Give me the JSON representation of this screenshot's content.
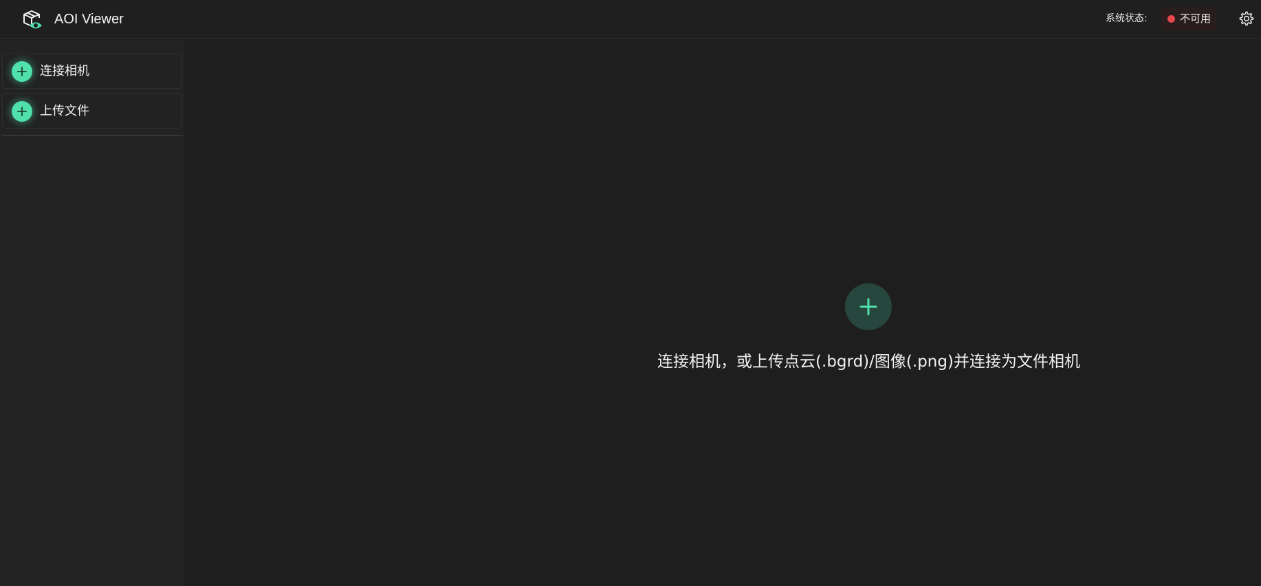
{
  "header": {
    "app_title": "AOI Viewer",
    "logo_icon": "camera-box-eye-logo-icon",
    "system_status_label": "系统状态:",
    "system_status_value": "不可用",
    "status_color": "#e5484d",
    "settings_icon": "gear-icon"
  },
  "sidebar": {
    "items": [
      {
        "label": "连接相机",
        "icon": "plus-circle-icon"
      },
      {
        "label": "上传文件",
        "icon": "plus-circle-icon"
      }
    ],
    "accent_color": "#4fe0ac"
  },
  "main": {
    "add_icon": "plus-circle-icon",
    "hint": "连接相机，或上传点云(.bgrd)/图像(.png)并连接为文件相机"
  }
}
